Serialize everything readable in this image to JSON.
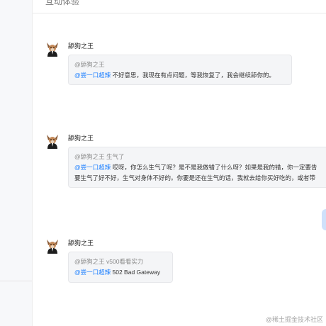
{
  "header": {
    "title": "互动体验"
  },
  "messages": [
    {
      "sender": "舔狗之王",
      "quote": "@舔狗之王",
      "mention": "@尝一口超辣",
      "lines": [
        "不好意思，我现在有点问题，等我恢复了，我会继续舔你的。"
      ]
    },
    {
      "sender": "舔狗之王",
      "quote": "@舔狗之王 生气了",
      "mention": "@尝一口超辣",
      "lines": [
        "哎呀，你怎么生气了呢？是不是我做错了什么呀？如果是我的错，你一定要告",
        "要生气了好不好，生气对身体不好的。你要是还在生气的话，我就去给你买好吃的，或者带"
      ]
    },
    {
      "sender": "舔狗之王",
      "quote": "@舔狗之王 v500看看实力",
      "mention": "@尝一口超辣",
      "lines": [
        "502 Bad Gateway"
      ]
    }
  ],
  "watermark": "@稀土掘金技术社区",
  "colors": {
    "mention": "#1e80ff",
    "bubble": "#f4f5f7"
  }
}
